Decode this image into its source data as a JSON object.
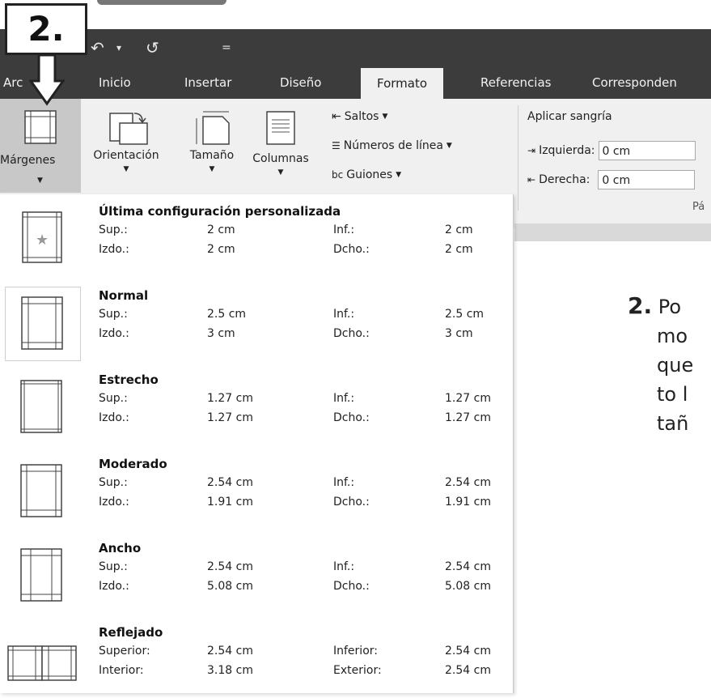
{
  "badge": {
    "text": "2."
  },
  "quick_access": {
    "undo": "↶",
    "dropdown": "▾",
    "redo": "↺",
    "customize": "="
  },
  "tabs": [
    {
      "label": "Arc",
      "active": false
    },
    {
      "label": "Inicio",
      "active": false
    },
    {
      "label": "Insertar",
      "active": false
    },
    {
      "label": "Diseño",
      "active": false
    },
    {
      "label": "Formato",
      "active": true
    },
    {
      "label": "Referencias",
      "active": false
    },
    {
      "label": "Corresponden",
      "active": false
    }
  ],
  "ribbon": {
    "margenes": "Márgenes",
    "orientacion": "Orientación",
    "tamano": "Tamaño",
    "columnas": "Columnas",
    "saltos": "Saltos",
    "numeros_linea": "Números de línea",
    "guiones": "Guiones",
    "aplicar_sangria": "Aplicar sangría",
    "izquierda_label": "Izquierda:",
    "izquierda_value": "0 cm",
    "derecha_label": "Derecha:",
    "derecha_value": "0 cm",
    "group_label": "Pá"
  },
  "margin_options": [
    {
      "title": "Última configuración personalizada",
      "l1": "Sup.:",
      "v1": "2 cm",
      "l2": "Inf.:",
      "v2": "2 cm",
      "l3": "Izdo.:",
      "v3": "2 cm",
      "l4": "Dcho.:",
      "v4": "2 cm"
    },
    {
      "title": "Normal",
      "l1": "Sup.:",
      "v1": "2.5 cm",
      "l2": "Inf.:",
      "v2": "2.5 cm",
      "l3": "Izdo.:",
      "v3": "3 cm",
      "l4": "Dcho.:",
      "v4": "3 cm"
    },
    {
      "title": "Estrecho",
      "l1": "Sup.:",
      "v1": "1.27 cm",
      "l2": "Inf.:",
      "v2": "1.27 cm",
      "l3": "Izdo.:",
      "v3": "1.27 cm",
      "l4": "Dcho.:",
      "v4": "1.27 cm"
    },
    {
      "title": "Moderado",
      "l1": "Sup.:",
      "v1": "2.54 cm",
      "l2": "Inf.:",
      "v2": "2.54 cm",
      "l3": "Izdo.:",
      "v3": "1.91 cm",
      "l4": "Dcho.:",
      "v4": "1.91 cm"
    },
    {
      "title": "Ancho",
      "l1": "Sup.:",
      "v1": "2.54 cm",
      "l2": "Inf.:",
      "v2": "2.54 cm",
      "l3": "Izdo.:",
      "v3": "5.08 cm",
      "l4": "Dcho.:",
      "v4": "5.08 cm"
    },
    {
      "title": "Reflejado",
      "l1": "Superior:",
      "v1": "2.54 cm",
      "l2": "Inferior:",
      "v2": "2.54 cm",
      "l3": "Interior:",
      "v3": "3.18 cm",
      "l4": "Exterior:",
      "v4": "2.54 cm"
    }
  ],
  "caption": {
    "num": "2.",
    "line1": "Po",
    "line2": "mo",
    "line3": "que",
    "line4": "to l",
    "line5": "tañ"
  },
  "colors": {
    "titlebar": "#3c3c3c",
    "ribbon": "#f0f0f0",
    "selected_button": "#c8c8c8"
  }
}
